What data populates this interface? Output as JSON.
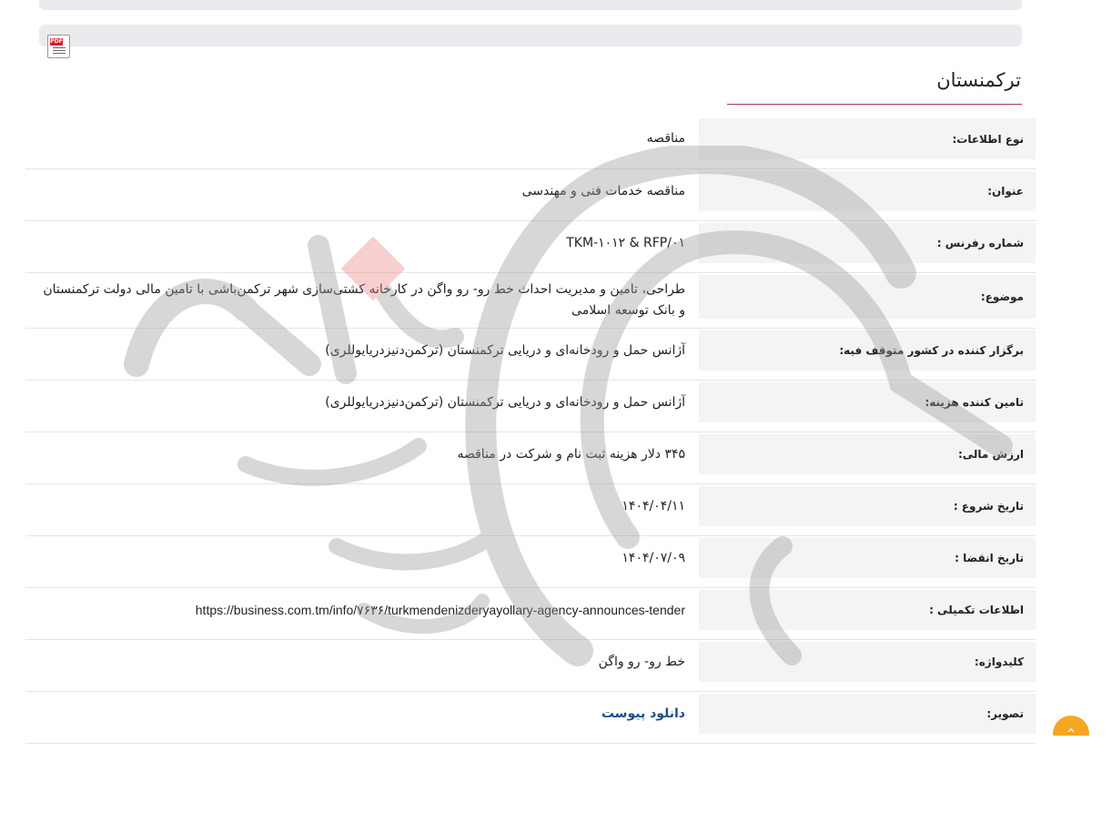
{
  "country_title": "ترکمنستان",
  "pdf_icon": "pdf-file-icon",
  "rows": [
    {
      "label": "نوع اطلاعات:",
      "value": "مناقصه"
    },
    {
      "label": "عنوان:",
      "value": "مناقصه خدمات فنی و مهندسی"
    },
    {
      "label": "شماره رفرنس :",
      "value": "TKM-۱۰۱۲ & RFP/۰۱"
    },
    {
      "label": "موضوع:",
      "value": "طراحی، تامین و مدیریت احداث خط رو- رو واگن در کارخانه کشتی‌سازی شهر ترکمن‌باشی با تامین مالی دولت ترکمنستان و بانک توسعه اسلامی"
    },
    {
      "label": "برگزار کننده در کشور متوقف فیه:",
      "value": "آژانس حمل و رودخانه‌ای و دریایی ترکمنستان (ترکمن‌دنیزدریایوللری)"
    },
    {
      "label": "تامین کننده هزینه:",
      "value": "آژانس حمل و رودخانه‌ای و دریایی ترکمنستان (ترکمن‌دنیزدریایوللری)"
    },
    {
      "label": "ارزش مالی:",
      "value": "۳۴۵ دلار هزینه ثبت نام و شرکت در مناقصه"
    },
    {
      "label": "تاریخ شروع :",
      "value": "۱۴۰۴/۰۴/۱۱"
    },
    {
      "label": "تاریخ انقضا :",
      "value": "۱۴۰۴/۰۷/۰۹"
    },
    {
      "label": "اطلاعات تکمیلی :",
      "value": "https://business.com.tm/info/۷۶۳۶/turkmendenizderyayollary-agency-announces-tender"
    },
    {
      "label": "کلیدواژه:",
      "value": "خط رو- رو واگن"
    },
    {
      "label": "تصویر:",
      "value": "دانلود پیوست"
    }
  ],
  "scroll_top_icon": "chevron-up-icon",
  "colors": {
    "accent_underline": "#b0306a",
    "link": "#1f4e8c",
    "scroll_button": "#f5a623",
    "label_bg": "#f4f4f4"
  }
}
